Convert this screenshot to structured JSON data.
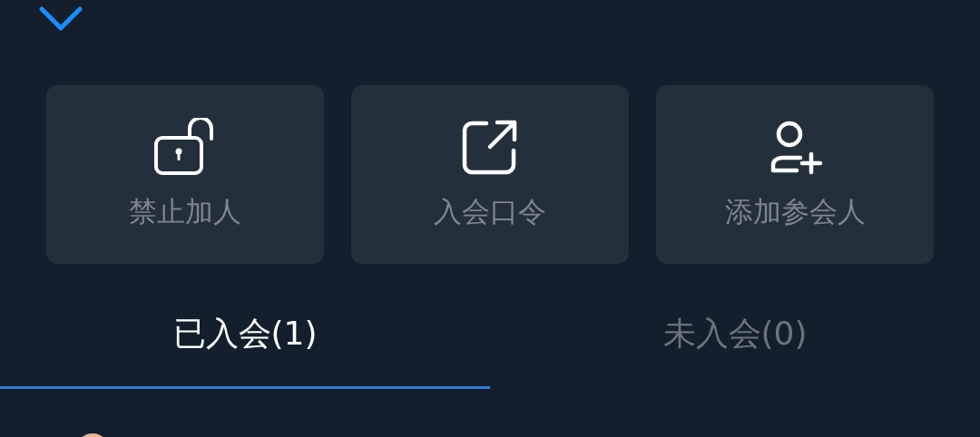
{
  "actions": [
    {
      "kind": "unlock",
      "label": "禁止加人"
    },
    {
      "kind": "share",
      "label": "入会口令"
    },
    {
      "kind": "add_user",
      "label": "添加参会人"
    }
  ],
  "tabs": [
    {
      "label": "已入会(1)",
      "selected": true
    },
    {
      "label": "未入会(0)",
      "selected": false
    }
  ]
}
